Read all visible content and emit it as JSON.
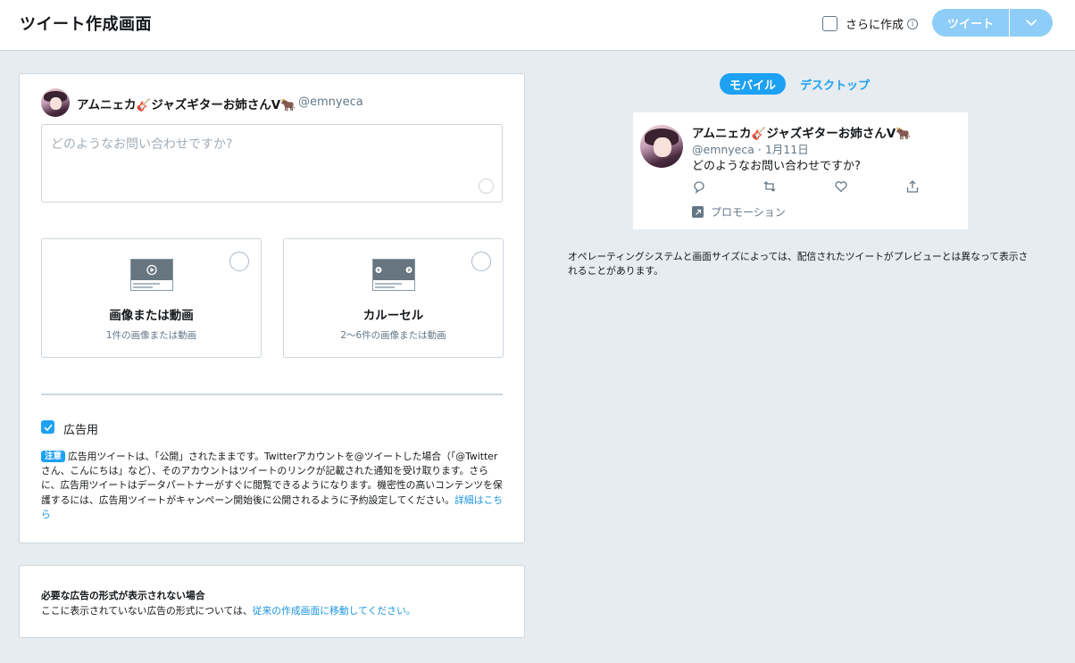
{
  "header": {
    "title": "ツイート作成画面",
    "more_create_label": "さらに作成",
    "tweet_button_label": "ツイート"
  },
  "composer": {
    "user_name": "アムニェカ🎸ジャズギターお姉さんV🐂",
    "user_handle": "@emnyeca",
    "placeholder": "どのようなお問い合わせですか?",
    "formats": [
      {
        "title": "画像または動画",
        "subtitle": "1件の画像または動画"
      },
      {
        "title": "カルーセル",
        "subtitle": "2〜6件の画像または動画"
      }
    ],
    "ad_label": "広告用",
    "notice_badge": "注意",
    "notice_text": "広告用ツイートは、「公開」されたままです。Twitterアカウントを@ツイートした場合（「@Twitterさん、こんにちは」など）、そのアカウントはツイートのリンクが記載された通知を受け取ります。さらに、広告用ツイートはデータパートナーがすぐに閲覧できるようになります。機密性の高いコンテンツを保護するには、広告用ツイートがキャンペーン開始後に公開されるように予約設定してください。",
    "notice_link": "詳細はこちら"
  },
  "info": {
    "title": "必要な広告の形式が表示されない場合",
    "text": "ここに表示されていない広告の形式については、",
    "link": "従来の作成画面に移動してください。"
  },
  "preview": {
    "tabs": [
      "モバイル",
      "デスクトップ"
    ],
    "user_name": "アムニェカ🎸ジャズギターお姉さんV🐂",
    "meta": "@emnyeca · 1月11日",
    "text": "どのようなお問い合わせですか?",
    "promo_label": "プロモーション",
    "note": "オペレーティングシステムと画面サイズによっては、配信されたツイートがプレビューとは異なって表示されることがあります。"
  },
  "colors": {
    "accent": "#1da1f2",
    "button_disabled": "#8ecdf8",
    "background": "#e6ecf0"
  }
}
